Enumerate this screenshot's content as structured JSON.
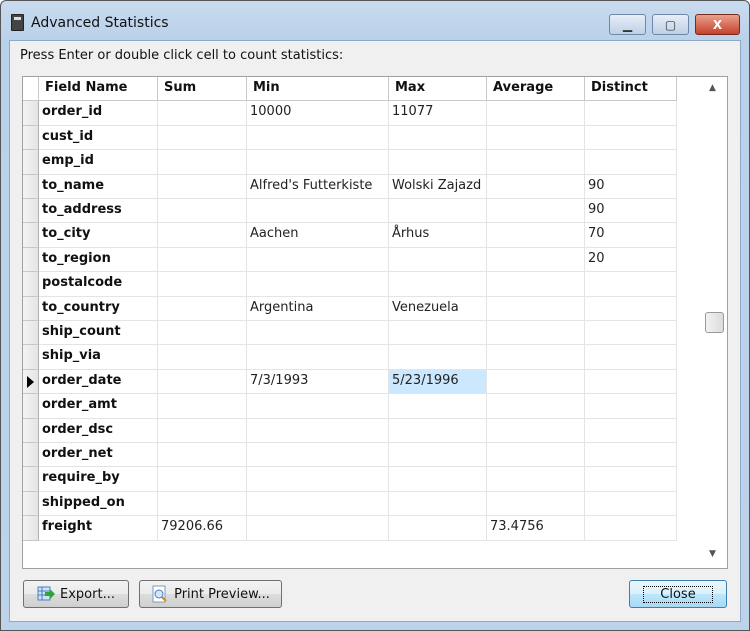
{
  "window": {
    "title": "Advanced Statistics",
    "minimize": "▁",
    "maximize": "▢",
    "close": "X"
  },
  "prompt": "Press Enter or double click cell to count statistics:",
  "columns": [
    "Field Name",
    "Sum",
    "Min",
    "Max",
    "Average",
    "Distinct"
  ],
  "rows": [
    [
      "order_id",
      "",
      "10000",
      "11077",
      "",
      ""
    ],
    [
      "cust_id",
      "",
      "",
      "",
      "",
      ""
    ],
    [
      "emp_id",
      "",
      "",
      "",
      "",
      ""
    ],
    [
      "to_name",
      "",
      "Alfred's Futterkiste",
      "Wolski Zajazd",
      "",
      "90"
    ],
    [
      "to_address",
      "",
      "",
      "",
      "",
      "90"
    ],
    [
      "to_city",
      "",
      "Aachen",
      "Århus",
      "",
      "70"
    ],
    [
      "to_region",
      "",
      "",
      "",
      "",
      "20"
    ],
    [
      "postalcode",
      "",
      "",
      "",
      "",
      ""
    ],
    [
      "to_country",
      "",
      "Argentina",
      "Venezuela",
      "",
      ""
    ],
    [
      "ship_count",
      "",
      "",
      "",
      "",
      ""
    ],
    [
      "ship_via",
      "",
      "",
      "",
      "",
      ""
    ],
    [
      "order_date",
      "",
      "7/3/1993",
      "5/23/1996",
      "",
      ""
    ],
    [
      "order_amt",
      "",
      "",
      "",
      "",
      ""
    ],
    [
      "order_dsc",
      "",
      "",
      "",
      "",
      ""
    ],
    [
      "order_net",
      "",
      "",
      "",
      "",
      ""
    ],
    [
      "require_by",
      "",
      "",
      "",
      "",
      ""
    ],
    [
      "shipped_on",
      "",
      "",
      "",
      "",
      ""
    ],
    [
      "freight",
      "79206.66",
      "",
      "",
      "73.4756",
      ""
    ]
  ],
  "current_row": 11,
  "selected_cell": {
    "row": 11,
    "col": 3
  },
  "buttons": {
    "export": "Export...",
    "print_preview": "Print Preview...",
    "close": "Close"
  },
  "scrollbar": {
    "up": "▲",
    "down": "▼",
    "position_fraction": 0.5
  }
}
